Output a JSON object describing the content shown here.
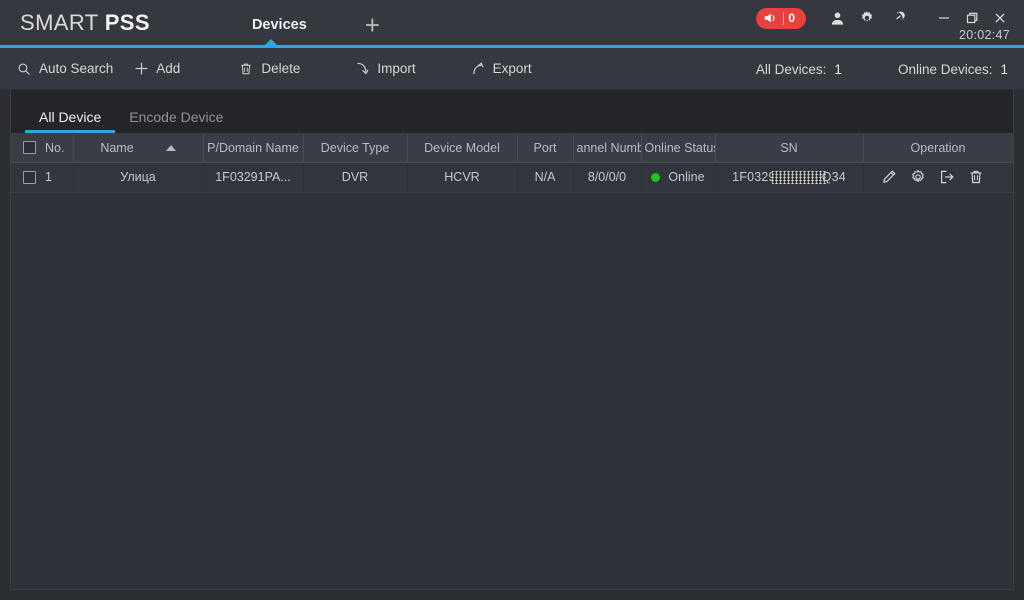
{
  "app": {
    "brand_first": "SMART ",
    "brand_second": "PSS",
    "clock": "20:02:47"
  },
  "titlebar": {
    "tabs": [
      {
        "label": "Devices",
        "active": true
      }
    ],
    "add_tab_label": "+",
    "alarm": {
      "icon": "speaker-icon",
      "count": "0",
      "color": "#e8413e"
    },
    "icons": [
      {
        "name": "user-icon"
      },
      {
        "name": "gear-icon"
      },
      {
        "name": "speedometer-icon"
      }
    ],
    "window_controls": [
      {
        "name": "minimize-button",
        "label": "—"
      },
      {
        "name": "maximize-button",
        "label": "❐"
      },
      {
        "name": "close-button",
        "label": "✕"
      }
    ],
    "accent_color": "#2aa9e0"
  },
  "toolbar": {
    "buttons": [
      {
        "name": "auto-search-button",
        "icon": "search-icon",
        "label": "Auto Search"
      },
      {
        "name": "add-button",
        "icon": "plus-icon",
        "label": "Add"
      },
      {
        "name": "delete-button",
        "icon": "trash-icon",
        "label": "Delete"
      },
      {
        "name": "import-button",
        "icon": "import-arrow-icon",
        "label": "Import"
      },
      {
        "name": "export-button",
        "icon": "export-arrow-icon",
        "label": "Export"
      }
    ],
    "all_devices_label": "All Devices:",
    "all_devices_value": "1",
    "online_devices_label": "Online Devices:",
    "online_devices_value": "1"
  },
  "device_tabs": [
    {
      "label": "All Device",
      "active": true
    },
    {
      "label": "Encode Device",
      "active": false
    }
  ],
  "table": {
    "headers": [
      "No.",
      "Name",
      "P/Domain Name",
      "Device Type",
      "Device Model",
      "Port",
      "annel Numb",
      "Online Status",
      "SN",
      "Operation"
    ],
    "sort": {
      "column": "Name",
      "direction": "asc"
    },
    "rows": [
      {
        "checked": false,
        "no": "1",
        "name": "Улица",
        "ip_domain": "1F03291PA...",
        "device_type": "DVR",
        "device_model": "HCVR",
        "port": "N/A",
        "channel_number": "8/0/0/0",
        "online_status": "Online",
        "online_status_color": "#1fc41f",
        "sn_prefix": "1F0329",
        "sn_suffix": "Q34",
        "operations": [
          {
            "name": "edit-icon"
          },
          {
            "name": "settings-gear-icon"
          },
          {
            "name": "logout-icon"
          },
          {
            "name": "delete-trash-icon"
          }
        ]
      }
    ]
  }
}
